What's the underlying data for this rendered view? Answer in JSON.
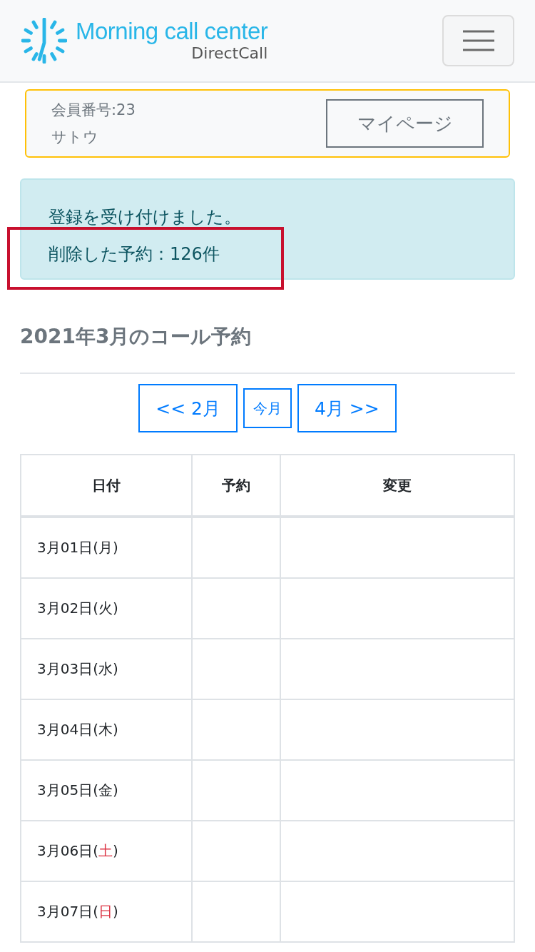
{
  "header": {
    "logo_title": "Morning call center",
    "logo_subtitle": "DirectCall"
  },
  "member": {
    "number": "会員番号:23",
    "name": "サトウ",
    "button": "マイページ"
  },
  "alert": {
    "lines": [
      "登録を受け付けました。",
      "削除した予約：126件"
    ]
  },
  "annotation": {
    "kind": "rectangle"
  },
  "section_title": "2021年3月のコール予約",
  "month_nav": [
    {
      "label": "<< 2月",
      "kind": "standard"
    },
    {
      "label": "今月",
      "kind": "compact"
    },
    {
      "label": "4月 >>",
      "kind": "standard"
    }
  ],
  "table": {
    "columns": [
      "日付",
      "予約",
      "変更"
    ],
    "rows": [
      {
        "date": "3月01日(",
        "weekday": "月",
        "close": ")",
        "weekend": false
      },
      {
        "date": "3月02日(",
        "weekday": "火",
        "close": ")",
        "weekend": false
      },
      {
        "date": "3月03日(",
        "weekday": "水",
        "close": ")",
        "weekend": false
      },
      {
        "date": "3月04日(",
        "weekday": "木",
        "close": ")",
        "weekend": false
      },
      {
        "date": "3月05日(",
        "weekday": "金",
        "close": ")",
        "weekend": false
      },
      {
        "date": "3月06日(",
        "weekday": "土",
        "close": ")",
        "weekend": true
      },
      {
        "date": "3月07日(",
        "weekday": "日",
        "close": ")",
        "weekend": true
      }
    ]
  }
}
